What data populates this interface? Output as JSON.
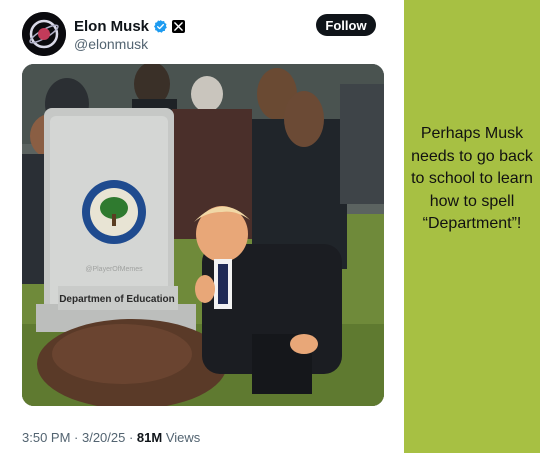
{
  "tweet": {
    "author": {
      "name": "Elon Musk",
      "handle": "@elonmusk",
      "verified_icon": "verified-badge-icon",
      "affiliation_icon": "x-logo-icon"
    },
    "follow_label": "Follow",
    "media": {
      "description_icon": "meme-image",
      "headstone_text": "Departmen of Education",
      "seal_text": "DEPARTMENT OF EDUCATION · UNITED STATES OF AMERICA",
      "watermark": "@PlayerOfMemes"
    },
    "meta": {
      "time": "3:50 PM",
      "separator1": " · ",
      "date": "3/20/25",
      "separator2": " · ",
      "views_count": "81M",
      "views_label": " Views"
    }
  },
  "sidebar": {
    "caption": "Perhaps Musk needs to go back to school to learn how to spell “Department”!",
    "background": "#a7c043"
  },
  "colors": {
    "follow_bg": "#0f1419",
    "verified_blue": "#1d9bf0",
    "muted_text": "#536471"
  }
}
